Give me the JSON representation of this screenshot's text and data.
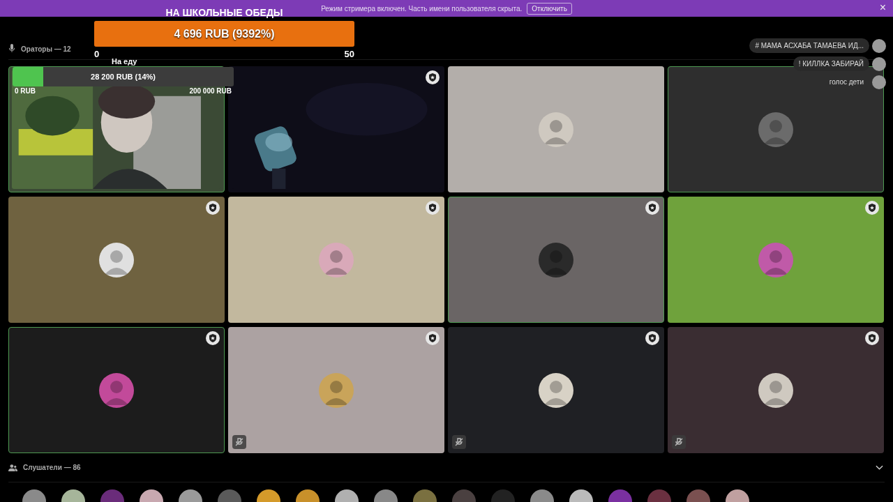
{
  "notice": {
    "text": "Режим стримера включен. Часть имени пользователя скрыта.",
    "button": "Отключить",
    "close": "×"
  },
  "goal": {
    "title": "НА ШКОЛЬНЫЕ ОБЕДЫ",
    "amount": "4 696 RUB (9392%)",
    "level": 1,
    "min": "0",
    "max": "50"
  },
  "goal_small": {
    "title": "На еду",
    "amount": "28 200 RUB (14%)",
    "level": 0.14,
    "min": "0 RUB",
    "max": "200 000 RUB"
  },
  "speakers": {
    "label": "Ораторы — 12",
    "tiles": [
      {
        "kind": "video",
        "speaking": true,
        "badge": false,
        "muted": false,
        "color": "#3b4a35"
      },
      {
        "kind": "video",
        "speaking": false,
        "badge": true,
        "muted": false,
        "color": "#0e0d18"
      },
      {
        "kind": "avatar",
        "speaking": false,
        "badge": false,
        "muted": false,
        "color": "#b3aeaa"
      },
      {
        "kind": "avatar",
        "speaking": true,
        "badge": false,
        "muted": false,
        "color": "#2e2e2e"
      },
      {
        "kind": "avatar",
        "speaking": false,
        "badge": true,
        "muted": false,
        "color": "#6f6240"
      },
      {
        "kind": "avatar",
        "speaking": false,
        "badge": true,
        "muted": false,
        "color": "#c2b89e"
      },
      {
        "kind": "avatar",
        "speaking": true,
        "badge": true,
        "muted": false,
        "color": "#6a6565"
      },
      {
        "kind": "avatar",
        "speaking": false,
        "badge": true,
        "muted": false,
        "color": "#6fa23c"
      },
      {
        "kind": "avatar",
        "speaking": true,
        "badge": true,
        "muted": false,
        "color": "#1c1c1c"
      },
      {
        "kind": "avatar",
        "speaking": false,
        "badge": true,
        "muted": true,
        "color": "#aca2a2"
      },
      {
        "kind": "avatar",
        "speaking": false,
        "badge": true,
        "muted": true,
        "color": "#1f2024"
      },
      {
        "kind": "avatar",
        "speaking": false,
        "badge": true,
        "muted": true,
        "color": "#3a2d32"
      }
    ]
  },
  "chat": [
    "# МАМА АСХАБА ТАМАЕВА ИД...",
    "! КИЛЛКА ЗАБИРАЙ",
    "голос дети"
  ],
  "listeners": {
    "label": "Слушатели — 86",
    "expanded": true
  }
}
